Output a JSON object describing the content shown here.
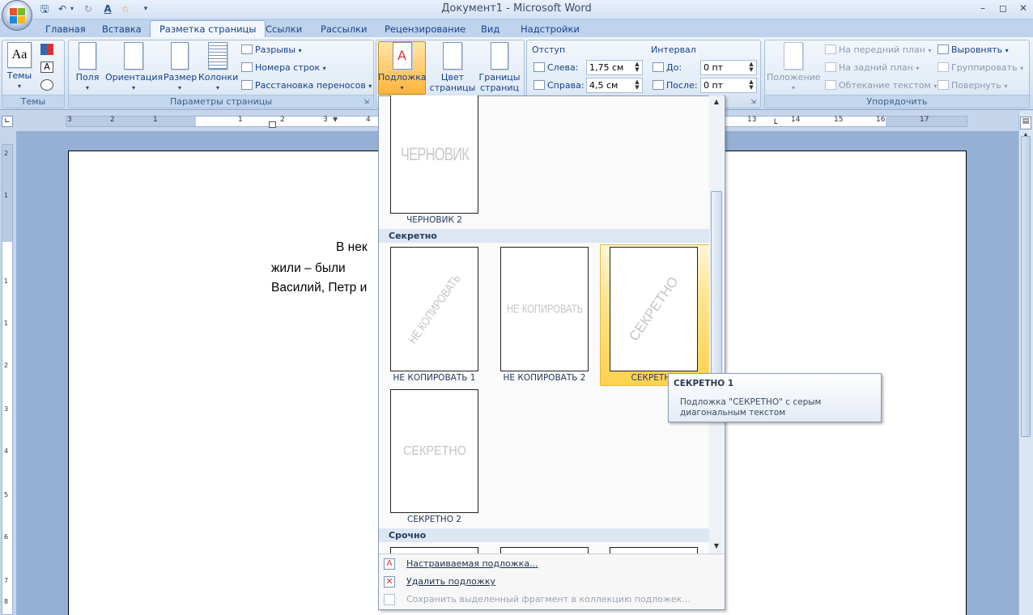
{
  "window": {
    "title": "Документ1 - Microsoft Word"
  },
  "qat": {
    "items": [
      "save-icon",
      "undo-icon",
      "redo-icon",
      "spellcheck-icon",
      "new-icon",
      "customize-icon"
    ]
  },
  "tabs": [
    "Главная",
    "Вставка",
    "Разметка страницы",
    "Ссылки",
    "Рассылки",
    "Рецензирование",
    "Вид",
    "Надстройки"
  ],
  "active_tab": "Разметка страницы",
  "ribbon": {
    "themes": {
      "label": "Темы",
      "button": "Темы"
    },
    "page_setup": {
      "label": "Параметры страницы",
      "fields": "Поля",
      "orientation": "Ориентация",
      "size": "Размер",
      "columns": "Колонки",
      "breaks": "Разрывы",
      "line_numbers": "Номера строк",
      "hyphenation": "Расстановка переносов"
    },
    "page_background": {
      "watermark": "Подложка",
      "page_color_1": "Цвет",
      "page_color_2": "страницы",
      "borders_1": "Границы",
      "borders_2": "страниц"
    },
    "paragraph": {
      "indent_title": "Отступ",
      "left_label": "Слева:",
      "left_value": "1,75 см",
      "right_label": "Справа:",
      "right_value": "4,5 см",
      "spacing_title": "Интервал",
      "before_label": "До:",
      "before_value": "0 пт",
      "after_label": "После:",
      "after_value": "0 пт"
    },
    "arrange": {
      "label": "Упорядочить",
      "position": "Положение",
      "bring_front": "На передний план",
      "send_back": "На задний план",
      "text_wrap": "Обтекание текстом",
      "align": "Выровнять",
      "group": "Группировать",
      "rotate": "Повернуть"
    }
  },
  "ruler": {
    "numbers": [
      "3",
      "2",
      "1",
      "1",
      "2",
      "3",
      "4",
      "13",
      "14",
      "15",
      "16",
      "17"
    ],
    "vnumbers": [
      "2",
      "1",
      "1",
      "1",
      "2",
      "3",
      "4",
      "5",
      "6",
      "7",
      "8"
    ]
  },
  "document": {
    "line1": "В  нек",
    "line2": "жили  –  были",
    "line3": "Василий, Петр и"
  },
  "gallery": {
    "top_thumb": {
      "watermark": "ЧЕРНОВИК",
      "caption": "ЧЕРНОВИК 2"
    },
    "section1": "Секретно",
    "items": [
      {
        "watermark": "НЕ КОПИРОВАТЬ",
        "caption": "НЕ КОПИРОВАТЬ 1"
      },
      {
        "watermark": "НЕ КОПИРОВАТЬ",
        "caption": "НЕ КОПИРОВАТЬ 2"
      },
      {
        "watermark": "СЕКРЕТНО",
        "caption": "СЕКРЕТНО"
      },
      {
        "watermark": "СЕКРЕТНО",
        "caption": "СЕКРЕТНО 2"
      }
    ],
    "section2": "Срочно",
    "footer": [
      {
        "label": "Настраиваемая подложка...",
        "enabled": true
      },
      {
        "label": "Удалить подложку",
        "enabled": true
      },
      {
        "label": "Сохранить выделенный фрагмент в коллекцию подложек...",
        "enabled": false
      }
    ]
  },
  "tooltip": {
    "title": "СЕКРЕТНО 1",
    "line1": "Подложка \"СЕКРЕТНО\" с серым",
    "line2": "диагональным текстом"
  },
  "colors": {
    "ribbon_accent": "#15428b",
    "selection": "#ffd24f"
  }
}
